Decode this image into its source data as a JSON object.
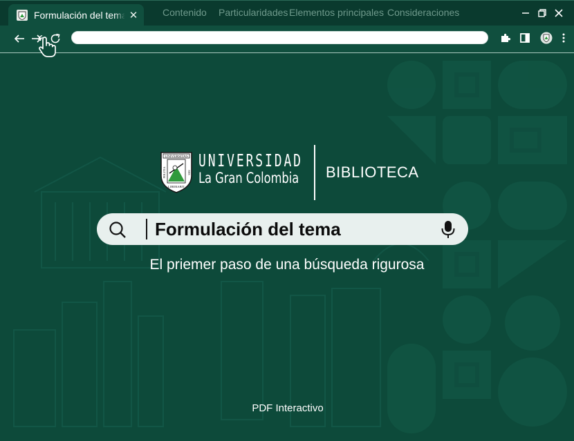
{
  "browser": {
    "active_tab": {
      "title": "Formulación del tema",
      "close_glyph": "✕"
    },
    "tabs": [
      {
        "label": "Contenido"
      },
      {
        "label": "Particularidades"
      },
      {
        "label": "Elementos principales"
      },
      {
        "label": "Consideraciones"
      }
    ],
    "window_controls": {
      "minimize": "—",
      "maximize": "❐",
      "close": "✕"
    },
    "nav": {
      "back": "←",
      "forward": "→",
      "reload": "↻"
    },
    "address": {
      "value": ""
    },
    "toolbar_icons": [
      "extensions-icon",
      "side-panel-icon",
      "profile-avatar-icon",
      "kebab-menu-icon"
    ]
  },
  "page": {
    "logo": {
      "line1": "UNIVERSIDAD",
      "line2": "La Gran Colombia",
      "section": "BIBLIOTECA",
      "shield_text": [
        "UNIVERSITAS",
        "POLITIA",
        "LIBERABIT",
        "SSS"
      ]
    },
    "search": {
      "value": "Formulación del tema"
    },
    "tagline": "El priemer paso de una búsqueda rigurosa",
    "footer": "PDF Interactivo"
  },
  "colors": {
    "background": "#0d4a3a",
    "tabstrip": "#0a3a2e",
    "search_bg": "#e8f0ee",
    "shield_green": "#2f9a3c"
  }
}
